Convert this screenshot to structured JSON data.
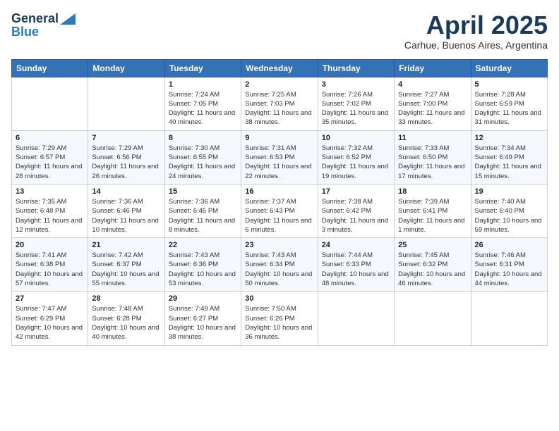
{
  "logo": {
    "general": "General",
    "blue": "Blue"
  },
  "title": "April 2025",
  "subtitle": "Carhue, Buenos Aires, Argentina",
  "days_of_week": [
    "Sunday",
    "Monday",
    "Tuesday",
    "Wednesday",
    "Thursday",
    "Friday",
    "Saturday"
  ],
  "weeks": [
    [
      {
        "day": "",
        "info": ""
      },
      {
        "day": "",
        "info": ""
      },
      {
        "day": "1",
        "info": "Sunrise: 7:24 AM\nSunset: 7:05 PM\nDaylight: 11 hours and 40 minutes."
      },
      {
        "day": "2",
        "info": "Sunrise: 7:25 AM\nSunset: 7:03 PM\nDaylight: 11 hours and 38 minutes."
      },
      {
        "day": "3",
        "info": "Sunrise: 7:26 AM\nSunset: 7:02 PM\nDaylight: 11 hours and 35 minutes."
      },
      {
        "day": "4",
        "info": "Sunrise: 7:27 AM\nSunset: 7:00 PM\nDaylight: 11 hours and 33 minutes."
      },
      {
        "day": "5",
        "info": "Sunrise: 7:28 AM\nSunset: 6:59 PM\nDaylight: 11 hours and 31 minutes."
      }
    ],
    [
      {
        "day": "6",
        "info": "Sunrise: 7:29 AM\nSunset: 6:57 PM\nDaylight: 11 hours and 28 minutes."
      },
      {
        "day": "7",
        "info": "Sunrise: 7:29 AM\nSunset: 6:56 PM\nDaylight: 11 hours and 26 minutes."
      },
      {
        "day": "8",
        "info": "Sunrise: 7:30 AM\nSunset: 6:55 PM\nDaylight: 11 hours and 24 minutes."
      },
      {
        "day": "9",
        "info": "Sunrise: 7:31 AM\nSunset: 6:53 PM\nDaylight: 11 hours and 22 minutes."
      },
      {
        "day": "10",
        "info": "Sunrise: 7:32 AM\nSunset: 6:52 PM\nDaylight: 11 hours and 19 minutes."
      },
      {
        "day": "11",
        "info": "Sunrise: 7:33 AM\nSunset: 6:50 PM\nDaylight: 11 hours and 17 minutes."
      },
      {
        "day": "12",
        "info": "Sunrise: 7:34 AM\nSunset: 6:49 PM\nDaylight: 11 hours and 15 minutes."
      }
    ],
    [
      {
        "day": "13",
        "info": "Sunrise: 7:35 AM\nSunset: 6:48 PM\nDaylight: 11 hours and 12 minutes."
      },
      {
        "day": "14",
        "info": "Sunrise: 7:36 AM\nSunset: 6:46 PM\nDaylight: 11 hours and 10 minutes."
      },
      {
        "day": "15",
        "info": "Sunrise: 7:36 AM\nSunset: 6:45 PM\nDaylight: 11 hours and 8 minutes."
      },
      {
        "day": "16",
        "info": "Sunrise: 7:37 AM\nSunset: 6:43 PM\nDaylight: 11 hours and 6 minutes."
      },
      {
        "day": "17",
        "info": "Sunrise: 7:38 AM\nSunset: 6:42 PM\nDaylight: 11 hours and 3 minutes."
      },
      {
        "day": "18",
        "info": "Sunrise: 7:39 AM\nSunset: 6:41 PM\nDaylight: 11 hours and 1 minute."
      },
      {
        "day": "19",
        "info": "Sunrise: 7:40 AM\nSunset: 6:40 PM\nDaylight: 10 hours and 59 minutes."
      }
    ],
    [
      {
        "day": "20",
        "info": "Sunrise: 7:41 AM\nSunset: 6:38 PM\nDaylight: 10 hours and 57 minutes."
      },
      {
        "day": "21",
        "info": "Sunrise: 7:42 AM\nSunset: 6:37 PM\nDaylight: 10 hours and 55 minutes."
      },
      {
        "day": "22",
        "info": "Sunrise: 7:43 AM\nSunset: 6:36 PM\nDaylight: 10 hours and 53 minutes."
      },
      {
        "day": "23",
        "info": "Sunrise: 7:43 AM\nSunset: 6:34 PM\nDaylight: 10 hours and 50 minutes."
      },
      {
        "day": "24",
        "info": "Sunrise: 7:44 AM\nSunset: 6:33 PM\nDaylight: 10 hours and 48 minutes."
      },
      {
        "day": "25",
        "info": "Sunrise: 7:45 AM\nSunset: 6:32 PM\nDaylight: 10 hours and 46 minutes."
      },
      {
        "day": "26",
        "info": "Sunrise: 7:46 AM\nSunset: 6:31 PM\nDaylight: 10 hours and 44 minutes."
      }
    ],
    [
      {
        "day": "27",
        "info": "Sunrise: 7:47 AM\nSunset: 6:29 PM\nDaylight: 10 hours and 42 minutes."
      },
      {
        "day": "28",
        "info": "Sunrise: 7:48 AM\nSunset: 6:28 PM\nDaylight: 10 hours and 40 minutes."
      },
      {
        "day": "29",
        "info": "Sunrise: 7:49 AM\nSunset: 6:27 PM\nDaylight: 10 hours and 38 minutes."
      },
      {
        "day": "30",
        "info": "Sunrise: 7:50 AM\nSunset: 6:26 PM\nDaylight: 10 hours and 36 minutes."
      },
      {
        "day": "",
        "info": ""
      },
      {
        "day": "",
        "info": ""
      },
      {
        "day": "",
        "info": ""
      }
    ]
  ]
}
